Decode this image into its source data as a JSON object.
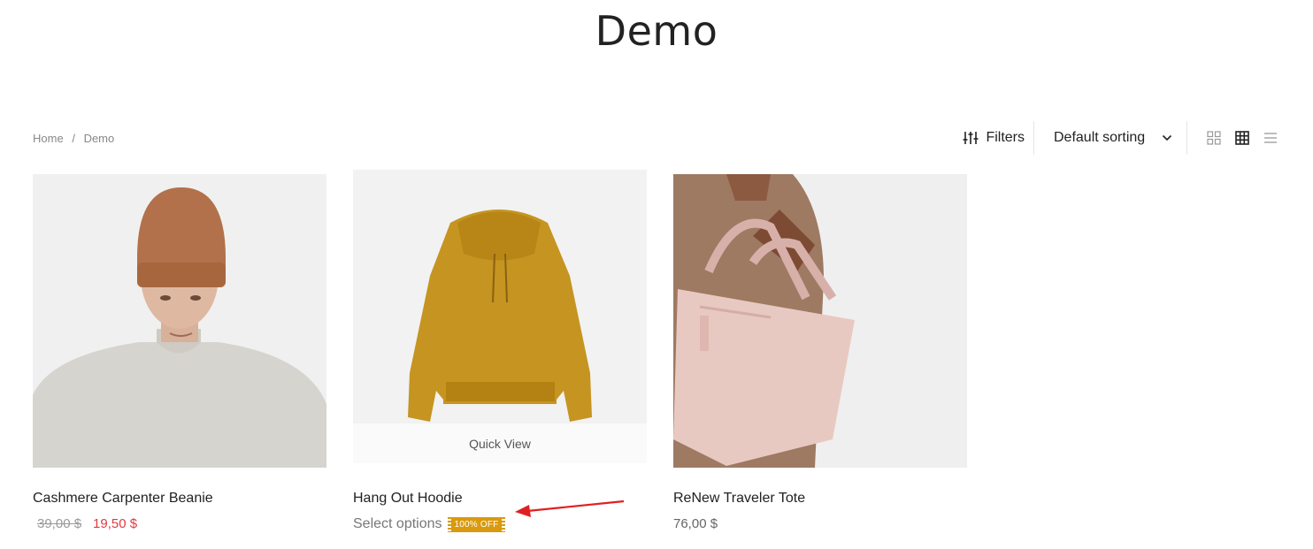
{
  "page": {
    "title": "Demo"
  },
  "breadcrumb": {
    "home": "Home",
    "separator": "/",
    "current": "Demo"
  },
  "toolbar": {
    "filters_label": "Filters",
    "sorting_label": "Default sorting",
    "view_modes": [
      "grid-2-icon",
      "grid-3-icon",
      "list-icon"
    ],
    "active_view": "grid-3-icon"
  },
  "products": [
    {
      "name": "Cashmere Carpenter Beanie",
      "old_price": "39,00 $",
      "price": "19,50 $"
    },
    {
      "name": "Hang Out Hoodie",
      "action": "Select options",
      "badge": "100% OFF",
      "quick_view": "Quick View"
    },
    {
      "name": "ReNew Traveler Tote",
      "price": "76,00 $"
    }
  ],
  "colors": {
    "sale_price": "#e0393e",
    "badge": "#d99a0e",
    "annotation_arrow": "#e02020"
  }
}
